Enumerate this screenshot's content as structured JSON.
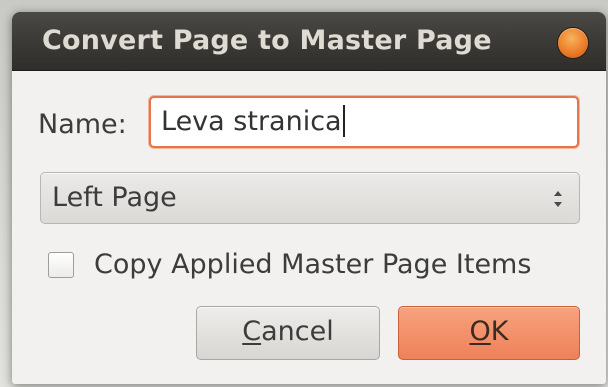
{
  "dialog": {
    "title": "Convert Page to Master Page"
  },
  "form": {
    "name_label": "Name:",
    "name_value": "Leva stranica",
    "page_select_value": "Left Page",
    "copy_items_label": "Copy Applied Master Page Items",
    "copy_items_checked": false
  },
  "buttons": {
    "cancel_mnemonic": "C",
    "cancel_rest": "ancel",
    "ok_mnemonic": "O",
    "ok_rest": "K"
  },
  "colors": {
    "titlebar": "#3b3a36",
    "close_button": "#ec7e2a",
    "accent_focus": "#e2764a",
    "ok_button": "#ee8159"
  },
  "icons": {
    "close": "close-icon",
    "combo": "updown-arrows-icon"
  }
}
